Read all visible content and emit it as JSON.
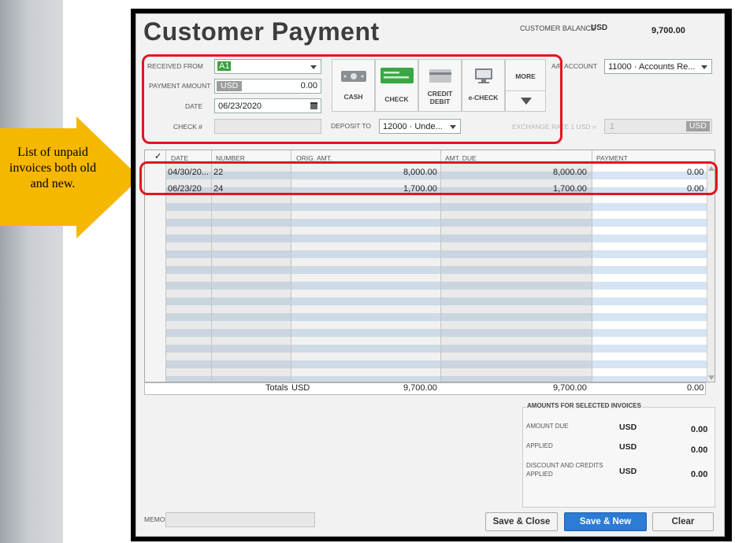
{
  "callout": {
    "text": "List of unpaid invoices both old and new."
  },
  "header": {
    "title": "Customer Payment",
    "customer_balance_label": "CUSTOMER BALANCE",
    "customer_balance_currency": "USD",
    "customer_balance_value": "9,700.00"
  },
  "form": {
    "received_from_label": "RECEIVED FROM",
    "received_from_value": "A1",
    "payment_amount_label": "PAYMENT AMOUNT",
    "payment_amount_currency": "USD",
    "payment_amount_value": "0.00",
    "date_label": "DATE",
    "date_value": "06/23/2020",
    "check_label": "CHECK #",
    "check_value": "",
    "deposit_to_label": "DEPOSIT TO",
    "deposit_to_value": "12000 · Unde...",
    "ar_account_label": "A/R ACCOUNT",
    "ar_account_value": "11000 · Accounts Re...",
    "exchange_rate_label": "EXCHANGE RATE 1 USD =",
    "exchange_rate_value": "1",
    "exchange_rate_currency": "USD"
  },
  "payment_methods": {
    "cash": "CASH",
    "check": "CHECK",
    "credit_debit_line1": "CREDIT",
    "credit_debit_line2": "DEBIT",
    "echeck": "e-CHECK",
    "more": "MORE"
  },
  "table": {
    "columns": {
      "check": "✓",
      "date": "DATE",
      "number": "NUMBER",
      "orig_amt": "ORIG. AMT.",
      "amt_due": "AMT. DUE",
      "payment": "PAYMENT"
    },
    "rows": [
      {
        "date": "04/30/20...",
        "number": "22",
        "orig_amt": "8,000.00",
        "amt_due": "8,000.00",
        "payment": "0.00"
      },
      {
        "date": "06/23/20",
        "number": "24",
        "orig_amt": "1,700.00",
        "amt_due": "1,700.00",
        "payment": "0.00"
      }
    ],
    "totals": {
      "label": "Totals",
      "currency": "USD",
      "orig_amt": "9,700.00",
      "amt_due": "9,700.00",
      "payment": "0.00"
    }
  },
  "amounts_panel": {
    "title": "AMOUNTS FOR SELECTED INVOICES",
    "amount_due_label": "AMOUNT DUE",
    "amount_due_currency": "USD",
    "amount_due_value": "0.00",
    "applied_label": "APPLIED",
    "applied_currency": "USD",
    "applied_value": "0.00",
    "discount_label_line1": "DISCOUNT AND CREDITS",
    "discount_label_line2": "APPLIED",
    "discount_currency": "USD",
    "discount_value": "0.00"
  },
  "footer": {
    "memo_label": "MEMO",
    "memo_value": "",
    "save_close": "Save & Close",
    "save_new": "Save & New",
    "clear": "Clear"
  },
  "colors": {
    "highlight_red": "#e3151f",
    "arrow_yellow": "#f5b700",
    "primary_blue": "#2b7bd7",
    "row_stripe": "#d6e4f3"
  }
}
